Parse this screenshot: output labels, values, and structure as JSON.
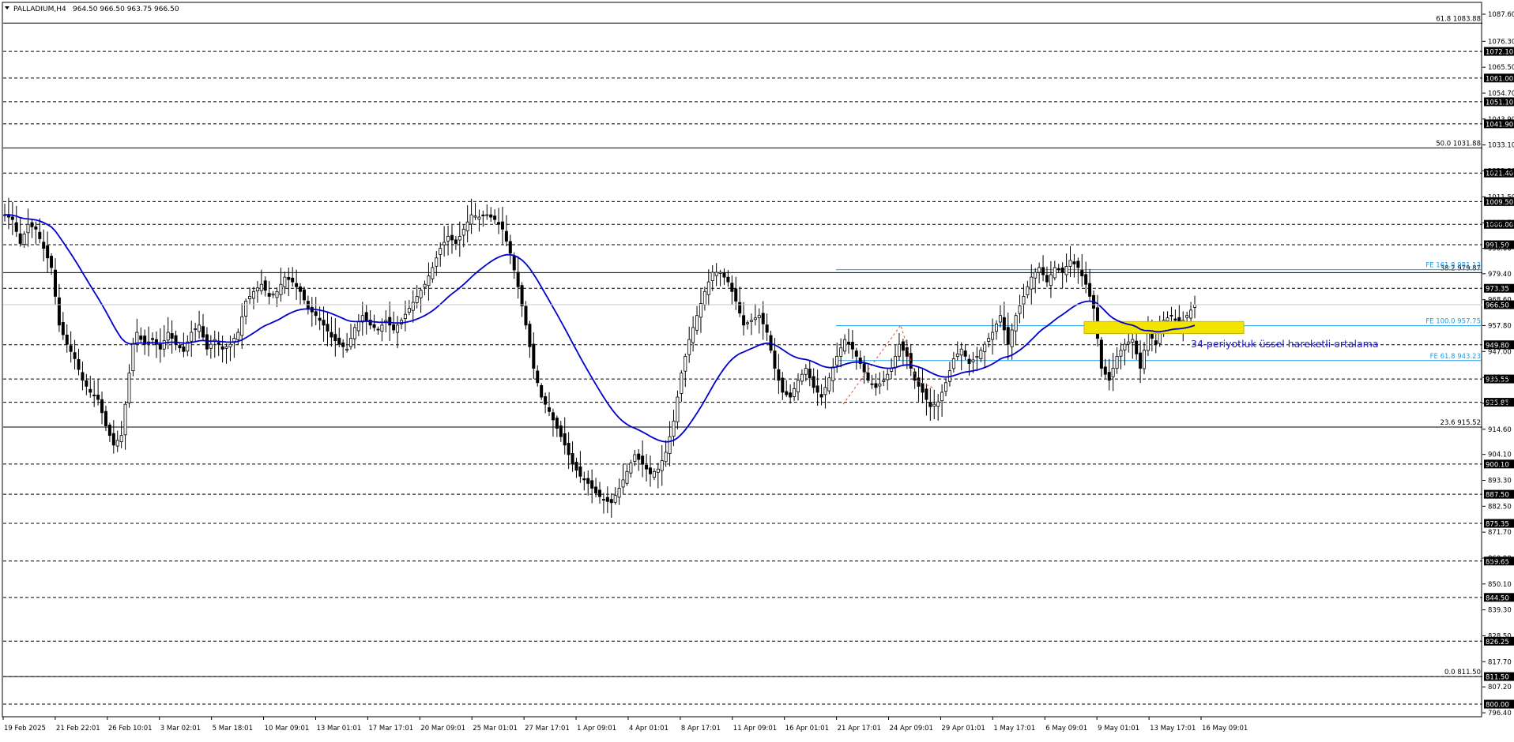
{
  "header": {
    "symbol_label": "PALLADIUM,H4",
    "ohlc_label": "964.50 966.50 963.75 966.50"
  },
  "colors": {
    "background": "#ffffff",
    "candle": "#000000",
    "ema": "#0000cc",
    "fe_line": "#1a9be8",
    "highlight": "#f2e400",
    "annotation_text": "#2020d0",
    "dashed_level": "#000000",
    "zigzag": "#e05030"
  },
  "chart_data": {
    "type": "candlestick",
    "symbol": "PALLADIUM",
    "timeframe": "H4",
    "ylim": [
      796.4,
      1087.6
    ],
    "grid": false,
    "y_tick_labels": [
      "1087.60",
      "1076.30",
      "1065.50",
      "1054.70",
      "1043.90",
      "1033.10",
      "1022.30",
      "1011.50",
      "1000.70",
      "990.00",
      "979.40",
      "968.60",
      "957.80",
      "947.00",
      "936.20",
      "925.40",
      "914.60",
      "904.10",
      "893.30",
      "882.50",
      "871.70",
      "860.90",
      "850.10",
      "839.30",
      "828.50",
      "817.70",
      "807.20",
      "796.40"
    ],
    "x_tick_labels": [
      "19 Feb 2025",
      "21 Feb 22:01",
      "26 Feb 10:01",
      "3 Mar 02:01",
      "5 Mar 18:01",
      "10 Mar 09:01",
      "13 Mar 01:01",
      "17 Mar 17:01",
      "20 Mar 09:01",
      "25 Mar 01:01",
      "27 Mar 17:01",
      "1 Apr 09:01",
      "4 Apr 01:01",
      "8 Apr 17:01",
      "11 Apr 09:01",
      "16 Apr 01:01",
      "21 Apr 17:01",
      "24 Apr 09:01",
      "29 Apr 01:01",
      "1 May 17:01",
      "6 May 09:01",
      "9 May 01:01",
      "13 May 17:01",
      "16 May 09:01"
    ],
    "current_price": 966.5,
    "horizontal_levels": [
      {
        "price": 1072.1,
        "label": "1072.10"
      },
      {
        "price": 1061.0,
        "label": "1061.00"
      },
      {
        "price": 1051.1,
        "label": "1051.10"
      },
      {
        "price": 1041.9,
        "label": "1041.90"
      },
      {
        "price": 1021.4,
        "label": "1021.40"
      },
      {
        "price": 1009.5,
        "label": "1009.50"
      },
      {
        "price": 1000.0,
        "label": "1000.00"
      },
      {
        "price": 991.5,
        "label": "991.50"
      },
      {
        "price": 973.35,
        "label": "973.35"
      },
      {
        "price": 949.8,
        "label": "949.80"
      },
      {
        "price": 935.55,
        "label": "935.55"
      },
      {
        "price": 925.85,
        "label": "925.85"
      },
      {
        "price": 900.1,
        "label": "900.10"
      },
      {
        "price": 887.5,
        "label": "887.50"
      },
      {
        "price": 875.35,
        "label": "875.35"
      },
      {
        "price": 859.65,
        "label": "859.65"
      },
      {
        "price": 844.5,
        "label": "844.50"
      },
      {
        "price": 826.25,
        "label": "826.25"
      },
      {
        "price": 811.5,
        "label": "811.50"
      },
      {
        "price": 800.0,
        "label": "800.00"
      }
    ],
    "fibonacci_retracement": [
      {
        "ratio": "61.8",
        "price": 1083.88,
        "label": "61.8 1083.88"
      },
      {
        "ratio": "50.0",
        "price": 1031.88,
        "label": "50.0 1031.88"
      },
      {
        "ratio": "38.2",
        "price": 979.87,
        "label": "38.2 979.87"
      },
      {
        "ratio": "23.6",
        "price": 915.52,
        "label": "23.6 915.52"
      },
      {
        "ratio": "0.0",
        "price": 811.5,
        "label": "0.0 811.50"
      }
    ],
    "fibonacci_expansion": [
      {
        "ratio": "161.8",
        "price": 981.13,
        "label": "FE 161.8 981.13"
      },
      {
        "ratio": "100.0",
        "price": 957.75,
        "label": "FE 100.0 957.75"
      },
      {
        "ratio": "61.8",
        "price": 943.23,
        "label": "FE 61.8 943.23"
      }
    ],
    "annotation": "34 periyotluk üssel hareketli ortalama",
    "ema_period": 34,
    "price_path": [
      [
        0,
        1004
      ],
      [
        2,
        1002
      ],
      [
        4,
        992
      ],
      [
        6,
        1000
      ],
      [
        8,
        998
      ],
      [
        10,
        990
      ],
      [
        12,
        982
      ],
      [
        13,
        970
      ],
      [
        14,
        958
      ],
      [
        16,
        950
      ],
      [
        18,
        944
      ],
      [
        20,
        935
      ],
      [
        22,
        930
      ],
      [
        24,
        927
      ],
      [
        26,
        916
      ],
      [
        27,
        912
      ],
      [
        28,
        908
      ],
      [
        30,
        912
      ],
      [
        31,
        925
      ],
      [
        32,
        938
      ],
      [
        33,
        950
      ],
      [
        34,
        955
      ],
      [
        35,
        952
      ],
      [
        36,
        950
      ],
      [
        38,
        952
      ],
      [
        40,
        948
      ],
      [
        42,
        955
      ],
      [
        44,
        950
      ],
      [
        46,
        947
      ],
      [
        48,
        955
      ],
      [
        50,
        958
      ],
      [
        52,
        948
      ],
      [
        54,
        952
      ],
      [
        56,
        948
      ],
      [
        58,
        950
      ],
      [
        60,
        955
      ],
      [
        62,
        968
      ],
      [
        64,
        972
      ],
      [
        66,
        975
      ],
      [
        68,
        970
      ],
      [
        70,
        972
      ],
      [
        72,
        978
      ],
      [
        74,
        976
      ],
      [
        76,
        972
      ],
      [
        78,
        965
      ],
      [
        80,
        962
      ],
      [
        82,
        958
      ],
      [
        84,
        953
      ],
      [
        86,
        950
      ],
      [
        88,
        948
      ],
      [
        90,
        957
      ],
      [
        92,
        962
      ],
      [
        94,
        958
      ],
      [
        96,
        956
      ],
      [
        98,
        960
      ],
      [
        100,
        956
      ],
      [
        102,
        960
      ],
      [
        104,
        965
      ],
      [
        106,
        970
      ],
      [
        108,
        975
      ],
      [
        110,
        982
      ],
      [
        112,
        990
      ],
      [
        114,
        995
      ],
      [
        116,
        992
      ],
      [
        118,
        998
      ],
      [
        120,
        1004
      ],
      [
        122,
        1003
      ],
      [
        124,
        1004
      ],
      [
        126,
        1002
      ],
      [
        128,
        998
      ],
      [
        130,
        988
      ],
      [
        132,
        974
      ],
      [
        134,
        958
      ],
      [
        136,
        940
      ],
      [
        138,
        928
      ],
      [
        140,
        922
      ],
      [
        142,
        915
      ],
      [
        144,
        908
      ],
      [
        146,
        900
      ],
      [
        148,
        895
      ],
      [
        150,
        892
      ],
      [
        152,
        888
      ],
      [
        154,
        885
      ],
      [
        156,
        884
      ],
      [
        158,
        890
      ],
      [
        160,
        897
      ],
      [
        162,
        904
      ],
      [
        164,
        900
      ],
      [
        166,
        896
      ],
      [
        168,
        898
      ],
      [
        170,
        905
      ],
      [
        172,
        918
      ],
      [
        174,
        938
      ],
      [
        176,
        952
      ],
      [
        178,
        962
      ],
      [
        180,
        972
      ],
      [
        182,
        980
      ],
      [
        184,
        980
      ],
      [
        186,
        976
      ],
      [
        188,
        968
      ],
      [
        190,
        958
      ],
      [
        192,
        960
      ],
      [
        194,
        962
      ],
      [
        196,
        955
      ],
      [
        198,
        940
      ],
      [
        200,
        930
      ],
      [
        202,
        928
      ],
      [
        204,
        935
      ],
      [
        206,
        940
      ],
      [
        208,
        932
      ],
      [
        210,
        928
      ],
      [
        212,
        936
      ],
      [
        214,
        945
      ],
      [
        216,
        952
      ],
      [
        218,
        948
      ],
      [
        220,
        942
      ],
      [
        222,
        935
      ],
      [
        224,
        932
      ],
      [
        226,
        935
      ],
      [
        228,
        940
      ],
      [
        230,
        950
      ],
      [
        232,
        945
      ],
      [
        234,
        935
      ],
      [
        236,
        930
      ],
      [
        238,
        924
      ],
      [
        240,
        926
      ],
      [
        242,
        934
      ],
      [
        244,
        944
      ],
      [
        246,
        948
      ],
      [
        248,
        942
      ],
      [
        250,
        945
      ],
      [
        252,
        950
      ],
      [
        254,
        955
      ],
      [
        256,
        962
      ],
      [
        258,
        950
      ],
      [
        260,
        962
      ],
      [
        262,
        970
      ],
      [
        264,
        978
      ],
      [
        266,
        982
      ],
      [
        268,
        976
      ],
      [
        270,
        982
      ],
      [
        272,
        980
      ],
      [
        274,
        985
      ],
      [
        276,
        982
      ],
      [
        278,
        975
      ],
      [
        280,
        965
      ],
      [
        282,
        940
      ],
      [
        284,
        935
      ],
      [
        286,
        945
      ],
      [
        288,
        950
      ],
      [
        290,
        952
      ],
      [
        292,
        940
      ],
      [
        294,
        955
      ],
      [
        296,
        950
      ],
      [
        298,
        960
      ],
      [
        300,
        962
      ],
      [
        302,
        958
      ],
      [
        304,
        962
      ],
      [
        306,
        966.5
      ]
    ]
  }
}
